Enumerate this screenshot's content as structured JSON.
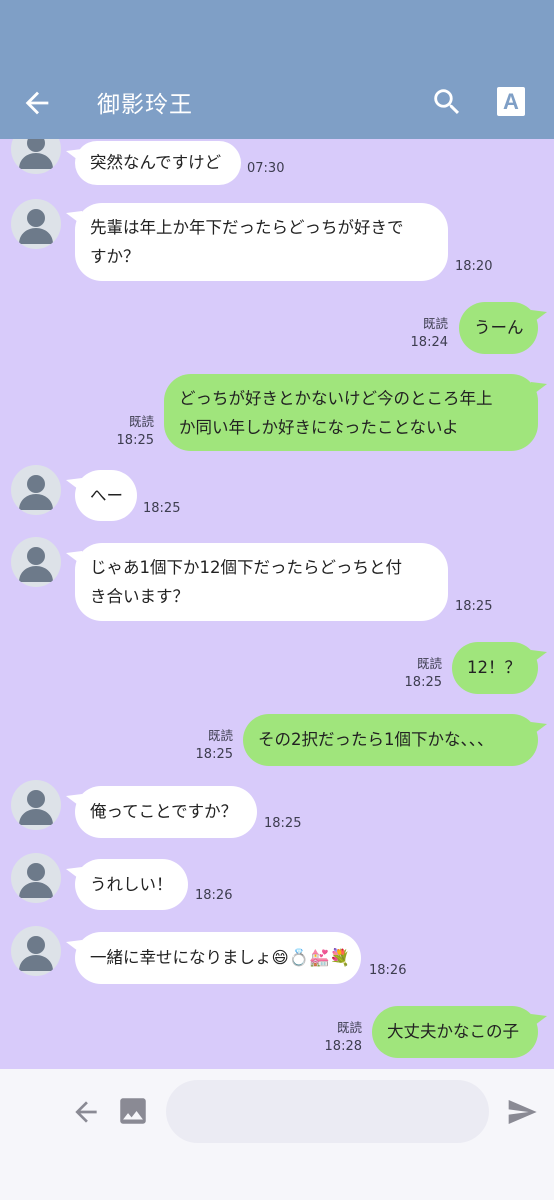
{
  "header": {
    "title": "御影玲王",
    "font_button_label": "A"
  },
  "messages": [
    {
      "side": "in",
      "text": "突然なんですけど",
      "time": "07:30"
    },
    {
      "side": "in",
      "text": "先輩は年上か年下だったらどっちが好きで\nすか？",
      "time": "18:20"
    },
    {
      "side": "out",
      "text": "うーん",
      "read": "既読",
      "time": "18:24"
    },
    {
      "side": "out",
      "text": "どっちが好きとかないけど今のところ年上\nか同い年しか好きになったことないよ",
      "read": "既読",
      "time": "18:25"
    },
    {
      "side": "in",
      "text": "へー",
      "time": "18:25"
    },
    {
      "side": "in",
      "text": "じゃあ1個下か12個下だったらどっちと付\nき合います？",
      "time": "18:25"
    },
    {
      "side": "out",
      "text": "12！？",
      "read": "既読",
      "time": "18:25"
    },
    {
      "side": "out",
      "text": "その2択だったら1個下かな、、、",
      "read": "既読",
      "time": "18:25"
    },
    {
      "side": "in",
      "text": "俺ってことですか？",
      "time": "18:25"
    },
    {
      "side": "in",
      "text": "うれしい！",
      "time": "18:26"
    },
    {
      "side": "in",
      "text": "一緒に幸せになりましょ😄💍💒💐",
      "time": "18:26"
    },
    {
      "side": "out",
      "text": "大丈夫かなこの子",
      "read": "既読",
      "time": "18:28"
    }
  ],
  "input": {
    "placeholder": ""
  },
  "colors": {
    "header": "#7f9fc6",
    "background": "#d8cbfa",
    "bubble_in": "#ffffff",
    "bubble_out": "#a0e57c"
  },
  "icons": {
    "back": "arrow-left-icon",
    "search": "search-icon",
    "font": "font-size-icon",
    "image": "image-icon",
    "send": "send-icon"
  }
}
